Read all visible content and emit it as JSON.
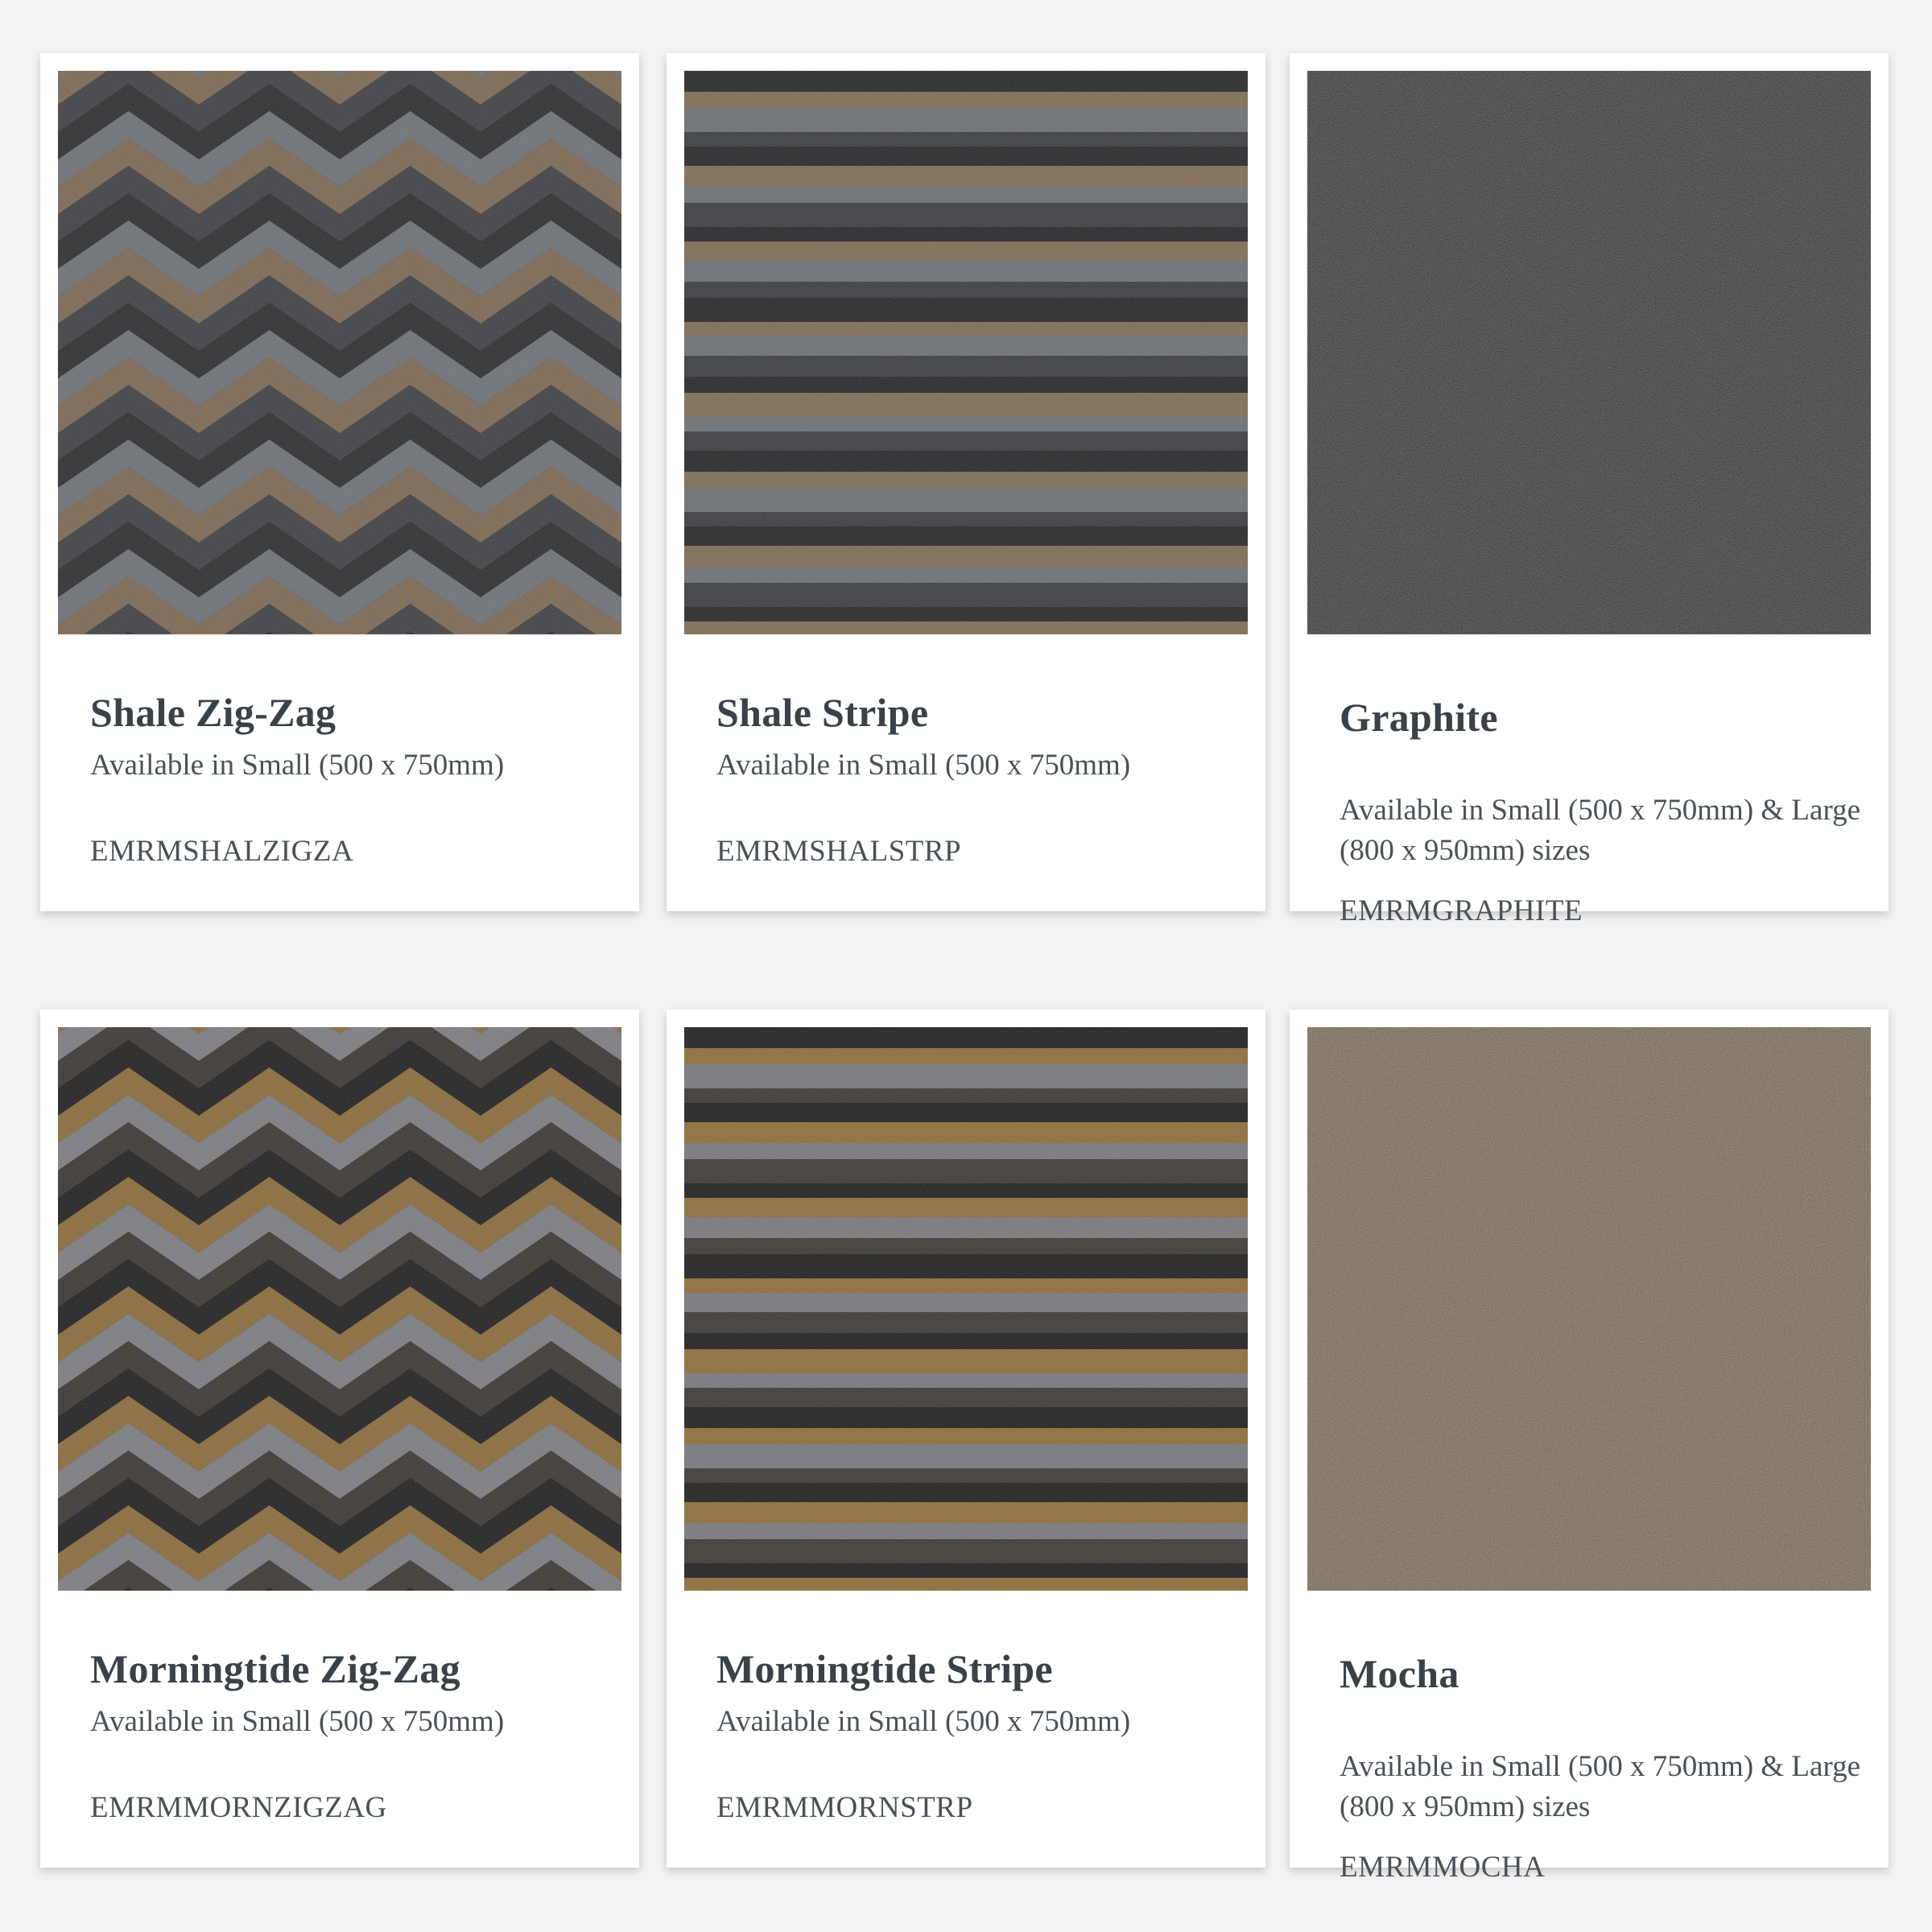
{
  "products": [
    {
      "name": "Shale Zig-Zag",
      "availability": "Available in Small (500 x 750mm)",
      "code": "EMRMSHALZIGZA",
      "swatch_icon": "zigzag-texture",
      "colors": [
        "#2a2a2c",
        "#6b6e73",
        "#7a6650",
        "#3c3d40"
      ]
    },
    {
      "name": "Shale Stripe",
      "availability": "Available in Small (500 x 750mm)",
      "code": "EMRMSHALSTRP",
      "swatch_icon": "stripe-texture",
      "colors": [
        "#242427",
        "#7d6a52",
        "#6a6d72",
        "#38393c"
      ]
    },
    {
      "name": "Graphite",
      "availability": "Available in Small (500 x 750mm) & Large (800 x 950mm) sizes",
      "code": "EMRMGRAPHITE",
      "swatch_icon": "speckle-texture",
      "colors": [
        "#2b2c2e",
        "#8c8e91"
      ]
    },
    {
      "name": "Morningtide Zig-Zag",
      "availability": "Available in Small (500 x 750mm)",
      "code": "EMRMMORNZIGZAG",
      "swatch_icon": "zigzag-texture",
      "colors": [
        "#1f1f21",
        "#8a6a3a",
        "#7a7c80",
        "#3a3632"
      ]
    },
    {
      "name": "Morningtide Stripe",
      "availability": "Available in Small (500 x 750mm)",
      "code": "EMRMMORNSTRP",
      "swatch_icon": "stripe-texture",
      "colors": [
        "#1e1e20",
        "#8e6c38",
        "#76787c",
        "#3b3835"
      ]
    },
    {
      "name": "Mocha",
      "availability": "Available in Small (500 x 750mm) & Large (800 x 950mm) sizes",
      "code": "EMRMMOCHA",
      "swatch_icon": "speckle-texture",
      "colors": [
        "#5e4e34",
        "#a08a5c"
      ]
    }
  ]
}
